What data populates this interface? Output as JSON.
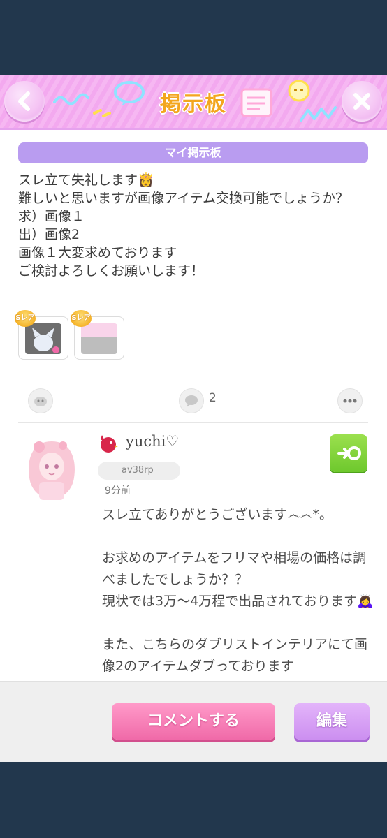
{
  "header": {
    "title": "掲示板"
  },
  "board": {
    "section_label": "マイ掲示板",
    "post_text": "スレ立て失礼します👸\n難しいと思いますが画像アイテム交換可能でしょうか？\n求）画像１\n出）画像2\n画像１大変求めております\nご検討よろしくお願いします！",
    "items": [
      {
        "rarity": "Sレア",
        "icon": "cat-ear-item-icon"
      },
      {
        "rarity": "Sレア",
        "icon": "pink-interior-item-icon"
      }
    ],
    "comment_count": "2"
  },
  "comment": {
    "username": "yuchi♡",
    "user_id": "av38rp",
    "time": "9分前",
    "text": "スレ立てありがとうございます෴෴*。\n\nお求めのアイテムをフリマや相場の価格は調べましたでしょうか？？\n現状では3万〜4万程で出品されております🙇‍♀️\n\nまた、こちらのダブリストインテリアにて画像2のアイテムダブっております\n😊"
  },
  "footer": {
    "comment_button": "コメントする",
    "edit_button": "編集"
  },
  "colors": {
    "header_pink": "#f6b7f2",
    "title_orange": "#f3a61f",
    "section_purple": "#b99cf0",
    "comment_pink": "#f06aa8",
    "edit_purple": "#cc8ff0",
    "action_green": "#6ec82d"
  }
}
